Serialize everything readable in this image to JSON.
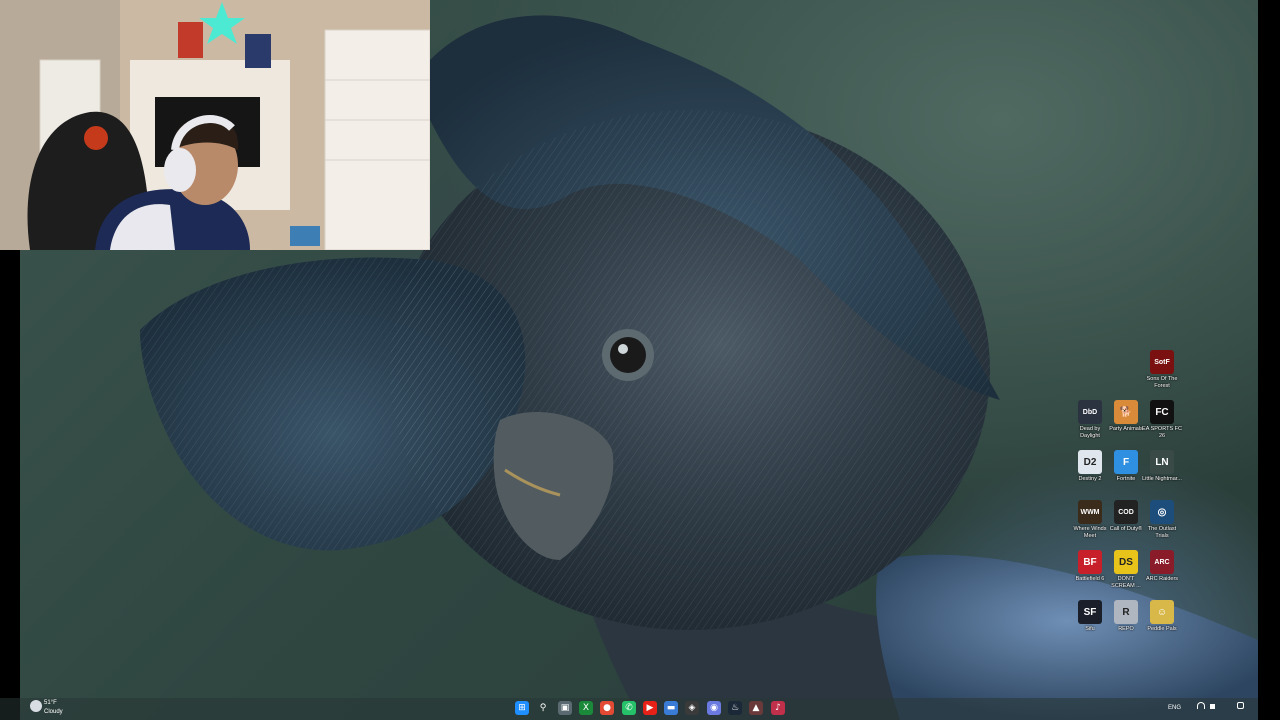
{
  "desktop": {
    "icons": [
      {
        "label": "Sons Of The Forest",
        "tile": "SotF",
        "color": "#7a1010",
        "icon": "sons-of-the-forest-icon"
      },
      {
        "label": "Dead by Daylight",
        "tile": "DbD",
        "color": "#2b3240",
        "icon": "dead-by-daylight-icon"
      },
      {
        "label": "Party Animals",
        "tile": "🐕",
        "color": "#d98b3a",
        "icon": "party-animals-icon"
      },
      {
        "label": "EA SPORTS FC 26",
        "tile": "FC",
        "color": "#111111",
        "icon": "ea-sports-fc-icon"
      },
      {
        "label": "Destiny 2",
        "tile": "D2",
        "color": "#dfe6ee",
        "icon": "destiny-2-icon"
      },
      {
        "label": "Fortnite",
        "tile": "F",
        "color": "#2f8fe0",
        "icon": "fortnite-icon"
      },
      {
        "label": "Little Nightmar...",
        "tile": "LN",
        "color": "#3a4a46",
        "icon": "little-nightmares-icon"
      },
      {
        "label": "Where Winds Meet",
        "tile": "WWM",
        "color": "#3b2b1b",
        "icon": "where-winds-meet-icon"
      },
      {
        "label": "Call of Duty®",
        "tile": "COD",
        "color": "#222222",
        "icon": "call-of-duty-icon"
      },
      {
        "label": "The Outlast Trials",
        "tile": "◎",
        "color": "#1d4d7a",
        "icon": "outlast-trials-icon"
      },
      {
        "label": "Battlefield 6",
        "tile": "BF",
        "color": "#c8202a",
        "icon": "battlefield-6-icon"
      },
      {
        "label": "DON'T SCREAM ...",
        "tile": "DS",
        "color": "#e8c41a",
        "icon": "dont-scream-icon"
      },
      {
        "label": "ARC Raiders",
        "tile": "ARC",
        "color": "#8a1c2a",
        "icon": "arc-raiders-icon"
      },
      {
        "label": "Sifu",
        "tile": "SF",
        "color": "#1a1f2a",
        "icon": "sifu-icon"
      },
      {
        "label": "REPO",
        "tile": "R",
        "color": "#b0b6c0",
        "icon": "repo-icon"
      },
      {
        "label": "Peddle Pals",
        "tile": "☺",
        "color": "#d9b84a",
        "icon": "peddle-pals-icon"
      }
    ]
  },
  "weather": {
    "temp": "51°F",
    "condition": "Cloudy"
  },
  "taskbar": {
    "items": [
      {
        "name": "start-button",
        "glyph": "⊞",
        "color": "#1f8fff"
      },
      {
        "name": "search-button",
        "glyph": "⚲",
        "color": "transparent"
      },
      {
        "name": "task-view-button",
        "glyph": "▣",
        "color": "#5a6a70"
      },
      {
        "name": "xbox-app",
        "glyph": "X",
        "color": "#1a8a3a"
      },
      {
        "name": "chrome-app",
        "glyph": "●",
        "color": "#e24a33"
      },
      {
        "name": "whatsapp-app",
        "glyph": "✆",
        "color": "#25c26a"
      },
      {
        "name": "youtube-app",
        "glyph": "▶",
        "color": "#e62117"
      },
      {
        "name": "file-explorer-app",
        "glyph": "▬",
        "color": "#3a7bd5"
      },
      {
        "name": "epic-app",
        "glyph": "◈",
        "color": "#3a3a3a"
      },
      {
        "name": "discord-app",
        "glyph": "◉",
        "color": "#6a7ae0"
      },
      {
        "name": "steam-app",
        "glyph": "♨",
        "color": "#1b2838"
      },
      {
        "name": "game-app",
        "glyph": "▲",
        "color": "#6a3a3a"
      },
      {
        "name": "tiktok-app",
        "glyph": "♪",
        "color": "#c0304a"
      }
    ],
    "tray_lang": "ENG"
  }
}
